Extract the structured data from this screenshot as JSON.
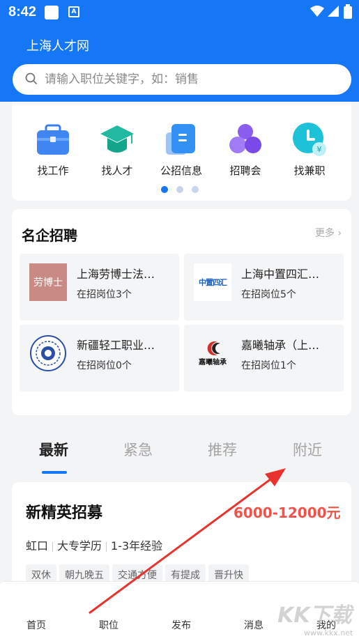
{
  "status": {
    "time": "8:42"
  },
  "header": {
    "brand": "上海人才网"
  },
  "search": {
    "placeholder": "请输入职位关键字，如：销售"
  },
  "quick_nav": {
    "items": [
      {
        "label": "找工作",
        "icon": "briefcase-icon"
      },
      {
        "label": "找人才",
        "icon": "graduation-cap-icon"
      },
      {
        "label": "公招信息",
        "icon": "document-icon"
      },
      {
        "label": "招聘会",
        "icon": "people-group-icon"
      },
      {
        "label": "找兼职",
        "icon": "clock-yuan-icon"
      }
    ],
    "page_count": 3,
    "active_page": 1
  },
  "famous": {
    "title": "名企招聘",
    "more": "更多",
    "companies": [
      {
        "name": "上海劳博士法…",
        "count": "在招岗位3个",
        "logo_text": "劳博士"
      },
      {
        "name": "上海中置四汇…",
        "count": "在招岗位5个",
        "logo_text": "中置四汇"
      },
      {
        "name": "新疆轻工职业…",
        "count": "在招岗位0个",
        "logo_text": ""
      },
      {
        "name": "嘉曦轴承（上…",
        "count": "在招岗位1个",
        "logo_text": "嘉曦轴承"
      }
    ]
  },
  "tabs": [
    {
      "label": "最新",
      "active": true
    },
    {
      "label": "紧急",
      "active": false
    },
    {
      "label": "推荐",
      "active": false
    },
    {
      "label": "附近",
      "active": false
    }
  ],
  "job": {
    "title": "新精英招募",
    "salary": "6000-12000元",
    "location": "虹口",
    "education": "大专学历",
    "experience": "1-3年经验",
    "tags": [
      "双休",
      "朝九晚五",
      "交通方便",
      "有提成",
      "晋升快"
    ]
  },
  "bottom_nav": [
    "首页",
    "职位",
    "发布",
    "消息",
    "我的"
  ],
  "watermark": {
    "text": "KK下载",
    "url": "www.kkx.net"
  },
  "colors": {
    "primary": "#1677f6",
    "salary": "#f0534c",
    "arrow": "#e8322e"
  }
}
